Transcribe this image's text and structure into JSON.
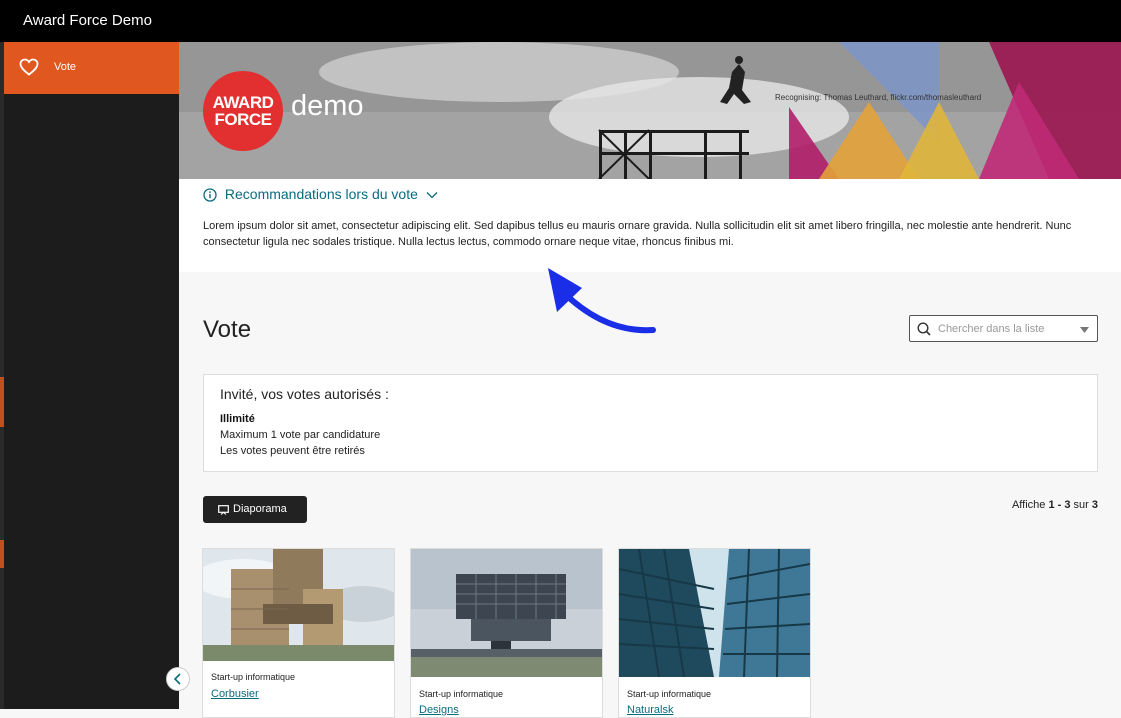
{
  "app": {
    "title": "Award Force Demo"
  },
  "sidebar": {
    "items": [
      {
        "label": "Vote",
        "icon": "heart-icon"
      }
    ]
  },
  "banner": {
    "logo_line1": "AWARD",
    "logo_line2": "FORCE",
    "demo_text": "demo",
    "credit": "Recognising: Thomas Leuthard, flickr.com/thomasleuthard"
  },
  "recommendations": {
    "header": "Recommandations lors du vote",
    "body": "Lorem ipsum dolor sit amet, consectetur adipiscing elit. Sed dapibus tellus eu mauris ornare gravida. Nulla sollicitudin elit sit amet libero fringilla, nec molestie ante hendrerit. Nunc consectetur ligula nec sodales tristique. Nulla lectus lectus, commodo ornare neque vitae, rhoncus finibus mi."
  },
  "main": {
    "title": "Vote",
    "search_placeholder": "Chercher dans la liste",
    "votes_box": {
      "heading": "Invité, vos votes autorisés :",
      "line1": "Illimité",
      "line2": "Maximum 1 vote par candidature",
      "line3": "Les votes peuvent être retirés"
    },
    "slideshow_label": "Diaporama",
    "count": {
      "prefix": "Affiche ",
      "range": "1 - 3",
      "middle": " sur ",
      "total": "3"
    }
  },
  "cards": [
    {
      "category": "Start-up informatique",
      "name": "Corbusier"
    },
    {
      "category": "Start-up informatique",
      "name": "Designs"
    },
    {
      "category": "Start-up informatique",
      "name": "Naturalsk"
    }
  ],
  "colors": {
    "accent": "#e0581f",
    "link": "#0a6b7e",
    "logo_red": "#e22f2f",
    "annotation_arrow": "#1a2ee8"
  }
}
